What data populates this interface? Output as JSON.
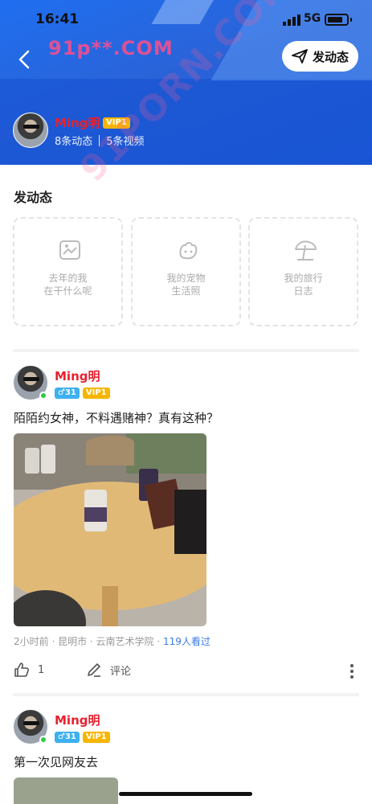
{
  "status_bar": {
    "time": "16:41",
    "network": "5G"
  },
  "header": {
    "watermark": "91p**.COM",
    "post_button_label": "发动态"
  },
  "profile": {
    "name": "Ming明",
    "vip": "VIP1",
    "posts_count": "8条动态",
    "videos_count": "5条视频"
  },
  "overlay_watermark": "91PORN.COM",
  "compose": {
    "title": "发动态",
    "cards": [
      {
        "line1": "去年的我",
        "line2": "在干什么呢",
        "icon": "picture-icon"
      },
      {
        "line1": "我的宠物",
        "line2": "生活照",
        "icon": "pet-icon"
      },
      {
        "line1": "我的旅行",
        "line2": "日志",
        "icon": "beach-umbrella-icon"
      }
    ]
  },
  "posts": [
    {
      "name": "Ming明",
      "gender_age": "♂31",
      "vip": "VIP1",
      "text": "陌陌约女神，不料遇赌神？真有这种？",
      "meta": "2小时前 · 昆明市 · 云南艺术学院 · ",
      "views": "119人看过",
      "likes": "1",
      "comment_label": "评论"
    },
    {
      "name": "Ming明",
      "gender_age": "♂31",
      "vip": "VIP1",
      "text": "第一次见网友去"
    }
  ],
  "colors": {
    "header_blue": "#2a63d8",
    "name_red": "#e8212e",
    "vip_gold": "#f7b500",
    "gender_blue": "#3cb0f0",
    "link_blue": "#3b7be8"
  }
}
